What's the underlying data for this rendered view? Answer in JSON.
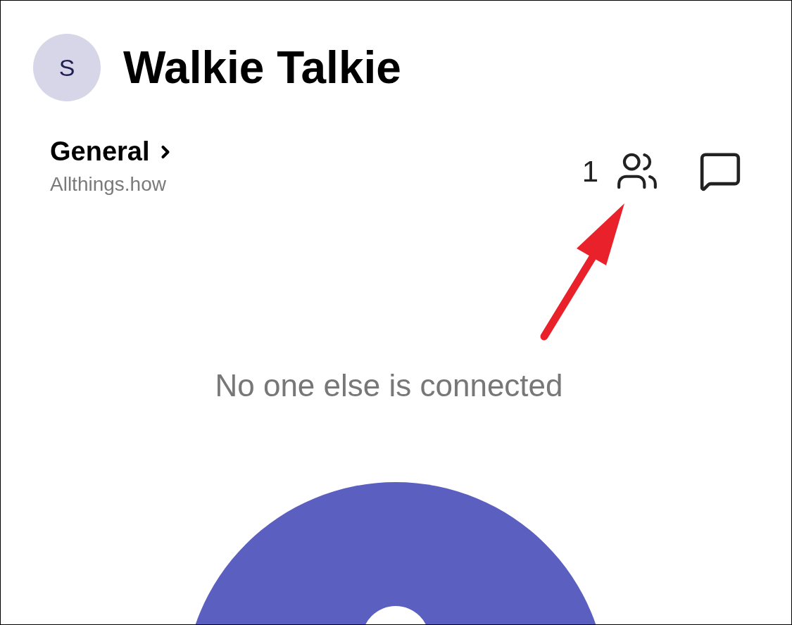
{
  "header": {
    "avatar_initial": "S",
    "title": "Walkie Talkie"
  },
  "channel": {
    "name": "General",
    "subtitle": "Allthings.how",
    "participant_count": "1"
  },
  "status_message": "No one else is connected"
}
